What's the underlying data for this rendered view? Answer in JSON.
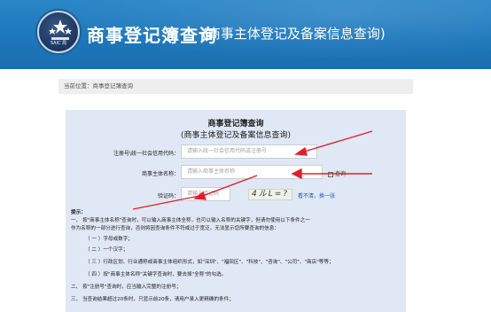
{
  "header": {
    "logo_text": "SAIC 局",
    "title_main": "商事登记簿查询",
    "title_sub": "(商事主体登记及备案信息查询)"
  },
  "breadcrumb": "当前位置：商事登记簿查询",
  "panel": {
    "title": "商事登记簿查询",
    "subtitle": "(商事主体登记及备案信息查询)"
  },
  "form": {
    "credit_code_label": "注册号\\统一社会信用代码：",
    "credit_code_placeholder": "请输入统一社会信用代码或注册号",
    "name_label": "商事主体名称：",
    "name_placeholder": "请输入商事主体名称",
    "search_label": "查询",
    "captcha_label": "验证码：",
    "captcha_placeholder": "请输入验证码",
    "captcha_text": "4ルL=?",
    "refresh_label": "看不清，换一张"
  },
  "tips": [
    "提示：",
    "一、 按\"商事主体名称\"查询时，可以输入商事主体全称，也可以输入名称的关键字，但请勿使用以下条件之一",
    "作为名称的一部分进行查询，否则将因查询条件不符或过于宽泛，无法显示您所要查询的信息：",
    "（ 一 ）字母或数字；",
    "（ 二 ）一个汉字；",
    "（ 三 ）行政区划、行业通称或商事主体组织形式，如\"深圳\"、\"福田区\"、\"科技\"、\"咨询\"、\"公司\"、\"商店\"等等；",
    "（ 四 ）按\"商事主体名称\"关键字查询时，要去掉\"全称\"的勾选。",
    "二、 按\"注册号\"查询时，应当输入完整的注册号；",
    "三、 当查询结果超过20条时，只显示前20条，请用户录入更精确的条件；"
  ],
  "colors": {
    "header_bg": "#1d77bb",
    "panel_bg": "#dfe8f4",
    "arrow": "#e0212a",
    "link": "#1f55b5"
  }
}
